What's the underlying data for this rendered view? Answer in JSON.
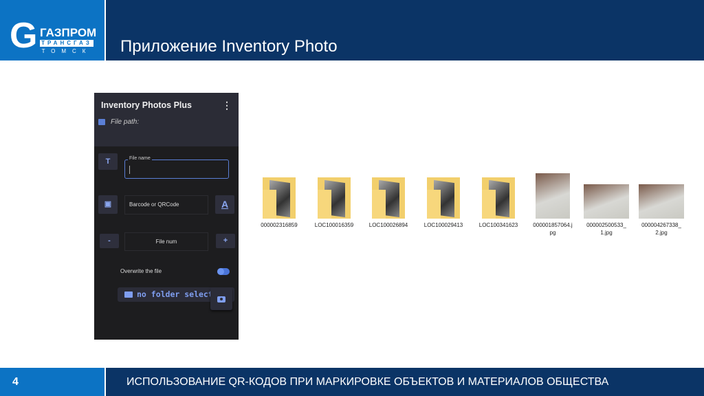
{
  "header": {
    "logo": {
      "brand": "ГАЗПРОМ",
      "line2": "ТРАНСГАЗ",
      "line3": "ТОМСК"
    },
    "title": "Приложение Inventory Photo"
  },
  "app": {
    "title": "Inventory Photos Plus",
    "menu_icon": "more-vert-icon",
    "file_path_label": "File path:",
    "text_btn": "T",
    "file_name_label": "File name",
    "file_name_value": "",
    "barcode_placeholder": "Barcode or QRCode",
    "minus": "-",
    "file_num_placeholder": "File num",
    "plus": "+",
    "overwrite_label": "Overwrite the file",
    "overwrite_on": true,
    "folder_btn": "no folder selected",
    "accent": "#5b7fd6"
  },
  "files": [
    {
      "name": "000002316859",
      "type": "folder"
    },
    {
      "name": "LOC100016359",
      "type": "folder"
    },
    {
      "name": "LOC100026894",
      "type": "folder"
    },
    {
      "name": "LOC100029413",
      "type": "folder"
    },
    {
      "name": "LOC100341623",
      "type": "folder"
    },
    {
      "name": "000001857064.jpg",
      "type": "image"
    },
    {
      "name": "000002500533_1.jpg",
      "type": "image"
    },
    {
      "name": "000004267338_2.jpg",
      "type": "image"
    }
  ],
  "footer": {
    "page": "4",
    "text": "ИСПОЛЬЗОВАНИЕ QR-КОДОВ ПРИ МАРКИРОВКЕ ОБЪЕКТОВ И МАТЕРИАЛОВ ОБЩЕСТВА"
  }
}
